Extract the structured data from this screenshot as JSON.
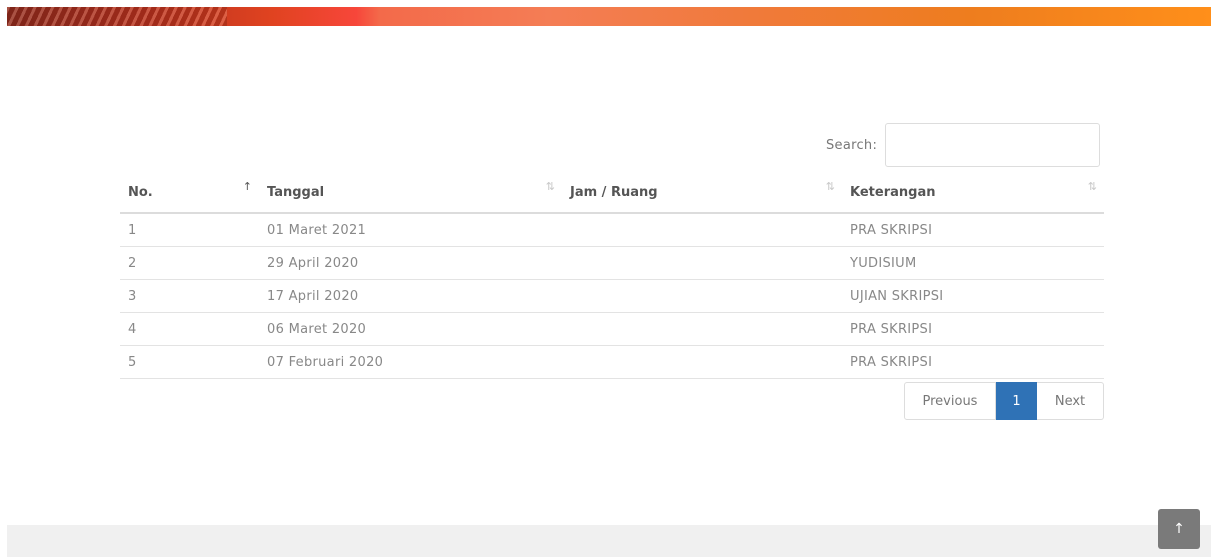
{
  "search": {
    "label": "Search:",
    "value": "",
    "placeholder": ""
  },
  "table": {
    "columns": [
      "No.",
      "Tanggal",
      "Jam / Ruang",
      "Keterangan"
    ],
    "sort_icons": {
      "active": "↑",
      "inactive": "⇅"
    },
    "rows": [
      {
        "no": "1",
        "tanggal": "01 Maret 2021",
        "jam_ruang": "",
        "keterangan": "PRA SKRIPSI"
      },
      {
        "no": "2",
        "tanggal": "29 April 2020",
        "jam_ruang": "",
        "keterangan": "YUDISIUM"
      },
      {
        "no": "3",
        "tanggal": "17 April 2020",
        "jam_ruang": "",
        "keterangan": "UJIAN SKRIPSI"
      },
      {
        "no": "4",
        "tanggal": "06 Maret 2020",
        "jam_ruang": "",
        "keterangan": "PRA SKRIPSI"
      },
      {
        "no": "5",
        "tanggal": "07 Februari 2020",
        "jam_ruang": "",
        "keterangan": "PRA SKRIPSI"
      }
    ]
  },
  "pagination": {
    "previous": "Previous",
    "current": "1",
    "next": "Next"
  },
  "scroll_top": {
    "icon": "arrow-up-icon",
    "glyph": "↑"
  },
  "colors": {
    "accent": "#2f72b6",
    "banner_start": "#b8321f",
    "banner_end": "#ff8f1a"
  }
}
